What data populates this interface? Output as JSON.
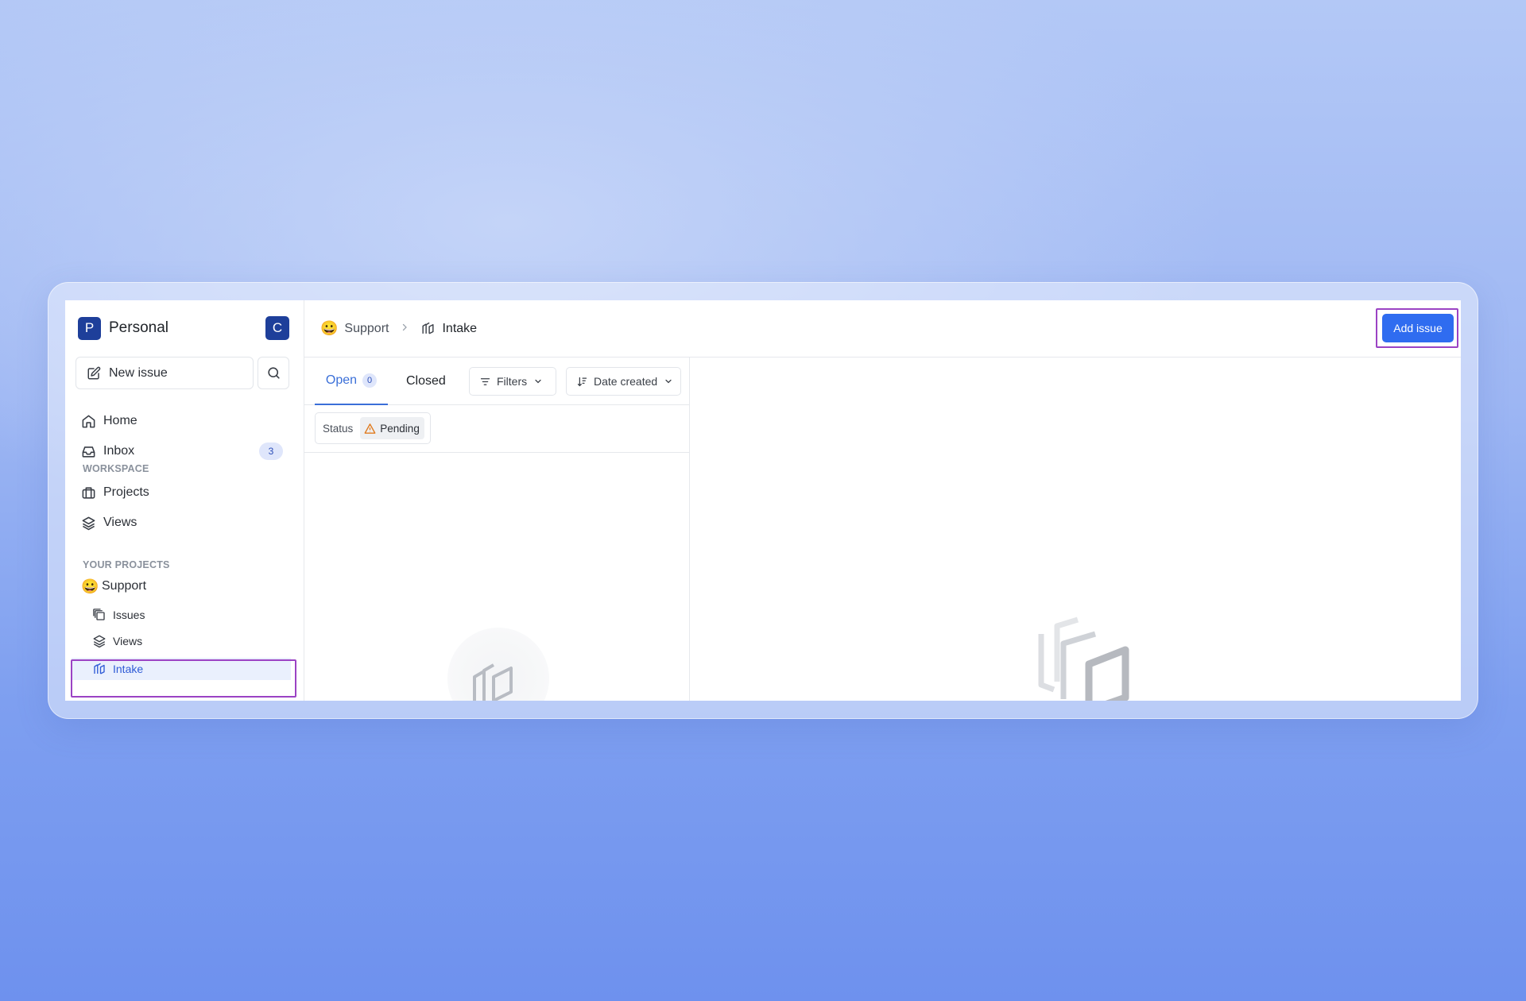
{
  "workspace": {
    "initial": "P",
    "name": "Personal",
    "user_initial": "C"
  },
  "sidebar": {
    "new_issue_label": "New issue",
    "nav": [
      {
        "label": "Home",
        "icon": "home-icon"
      },
      {
        "label": "Inbox",
        "icon": "inbox-icon",
        "badge": "3"
      }
    ],
    "workspace_section_label": "WORKSPACE",
    "workspace_items": [
      {
        "label": "Projects",
        "icon": "briefcase-icon"
      },
      {
        "label": "Views",
        "icon": "layers-icon"
      }
    ],
    "projects_section_label": "YOUR PROJECTS",
    "project": {
      "emoji": "😀",
      "name": "Support",
      "items": [
        {
          "label": "Issues",
          "icon": "issues-icon"
        },
        {
          "label": "Views",
          "icon": "layers-icon"
        },
        {
          "label": "Intake",
          "icon": "intake-icon",
          "active": true
        }
      ]
    }
  },
  "header": {
    "breadcrumb": [
      {
        "label": "Support",
        "emoji": "😀"
      },
      {
        "label": "Intake",
        "icon": "intake-icon"
      }
    ],
    "add_issue_label": "Add issue"
  },
  "list": {
    "tabs": [
      {
        "label": "Open",
        "count": "0",
        "active": true
      },
      {
        "label": "Closed",
        "active": false
      }
    ],
    "filters_label": "Filters",
    "sort_label": "Date created",
    "status_filter": {
      "label": "Status",
      "value": "Pending"
    }
  },
  "colors": {
    "accent": "#2f6cf0",
    "highlight": "#9b43c4",
    "workspace_avatar": "#1e3f9a",
    "pending_warning": "#e07b20"
  }
}
